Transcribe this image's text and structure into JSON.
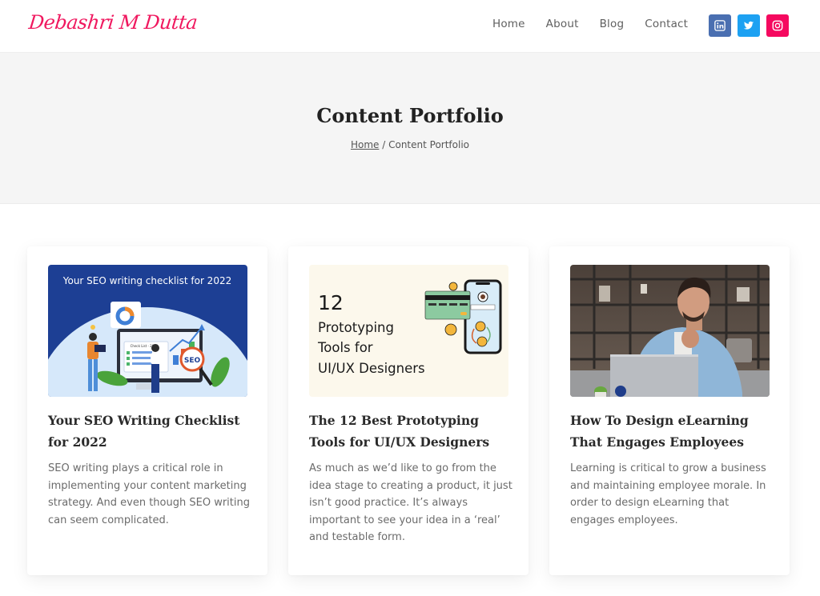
{
  "site": {
    "logo": "Debashri M Dutta",
    "brand_color": "#f0185f"
  },
  "nav": {
    "items": [
      {
        "label": "Home"
      },
      {
        "label": "About"
      },
      {
        "label": "Blog"
      },
      {
        "label": "Contact"
      }
    ]
  },
  "social": [
    {
      "name": "linkedin",
      "icon": "linkedin-icon",
      "color": "#4a6fb1"
    },
    {
      "name": "twitter",
      "icon": "twitter-icon",
      "color": "#1da1f2"
    },
    {
      "name": "instagram",
      "icon": "instagram-icon",
      "color": "#f5095f"
    }
  ],
  "hero": {
    "title": "Content Portfolio",
    "breadcrumb": {
      "home": "Home",
      "separator": " / ",
      "current": "Content Portfolio"
    }
  },
  "posts": [
    {
      "image": {
        "banner_text": "Your SEO writing checklist for 2022",
        "checklist_label": "Check List - 2022",
        "badge": "SEO"
      },
      "title": "Your SEO Writing Checklist for 2022",
      "excerpt": "SEO writing plays a critical role in implementing your content marketing strategy. And even though SEO writing can seem complicated."
    },
    {
      "image": {
        "number": "12",
        "line1": "Prototyping",
        "line2": "Tools for",
        "line3": "UI/UX Designers"
      },
      "title": "The 12 Best Prototyping Tools for UI/UX Designers",
      "excerpt": "As much as we’d like to go from the idea stage to creating a product, it just isn’t good practice. It’s always important to see your idea in a ‘real’ and testable form."
    },
    {
      "image": {
        "alt": "smiling man working on laptop"
      },
      "title": "How To Design eLearning That Engages Employees",
      "excerpt": "Learning is critical to grow a business and maintaining employee morale. In order to design eLearning that engages employees."
    }
  ]
}
